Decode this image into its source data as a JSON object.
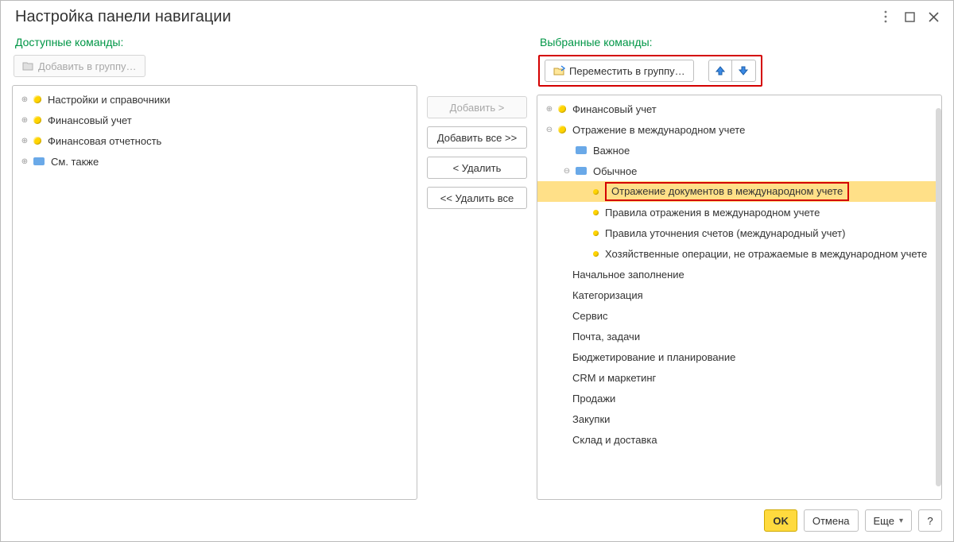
{
  "window": {
    "title": "Настройка панели навигации"
  },
  "labels": {
    "available": "Доступные команды:",
    "selected": "Выбранные команды:"
  },
  "toolbar": {
    "add_to_group": "Добавить в группу…",
    "move_to_group": "Переместить в группу…"
  },
  "mid_buttons": {
    "add": "Добавить >",
    "add_all": "Добавить все >>",
    "remove": "< Удалить",
    "remove_all": "<< Удалить все"
  },
  "footer": {
    "ok": "OK",
    "cancel": "Отмена",
    "more": "Еще",
    "help": "?"
  },
  "left_tree": {
    "i0": "Настройки и справочники",
    "i1": "Финансовый учет",
    "i2": "Финансовая отчетность",
    "i3": "См. также"
  },
  "right_tree": {
    "r0": "Финансовый учет",
    "r1": "Отражение в международном учете",
    "r1a": "Важное",
    "r1b": "Обычное",
    "r1b0": "Отражение документов в международном учете",
    "r1b1": "Правила отражения в международном учете",
    "r1b2": "Правила уточнения счетов (международный учет)",
    "r1b3": "Хозяйственные операции, не отражаемые в международном учете",
    "r2": "Начальное заполнение",
    "r3": "Категоризация",
    "r4": "Сервис",
    "r5": "Почта, задачи",
    "r6": "Бюджетирование и планирование",
    "r7": "CRM и маркетинг",
    "r8": "Продажи",
    "r9": "Закупки",
    "r10": "Склад и доставка"
  }
}
